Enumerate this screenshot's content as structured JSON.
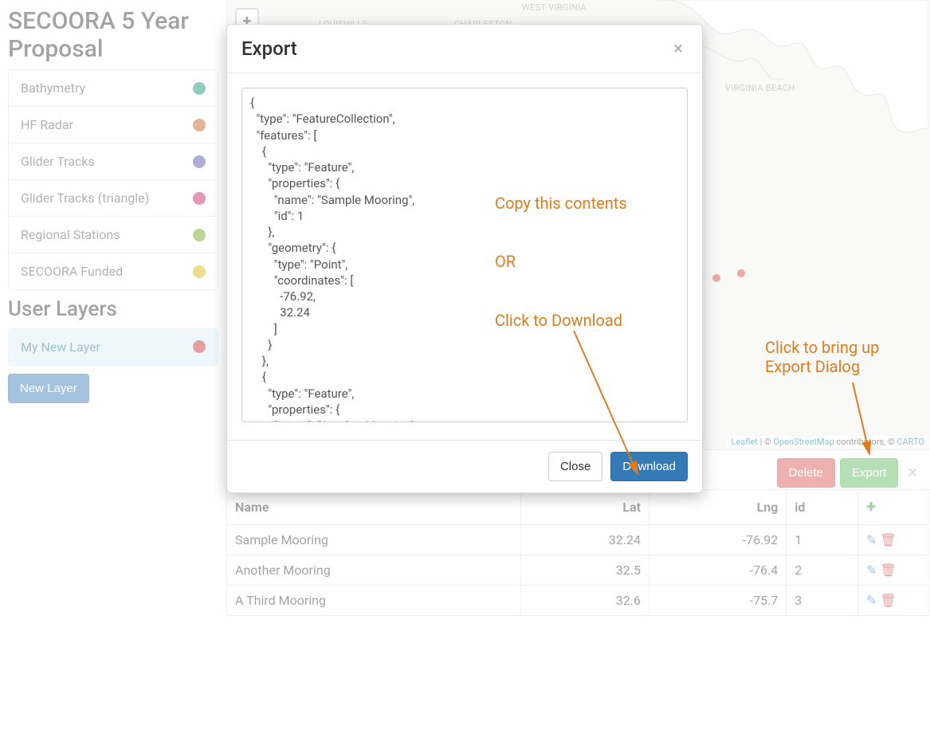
{
  "sidebar": {
    "title": "SECOORA 5 Year Proposal",
    "layers": [
      {
        "label": "Bathymetry",
        "color": "#0c8f6a"
      },
      {
        "label": "HF Radar",
        "color": "#c55a11"
      },
      {
        "label": "Glider Tracks",
        "color": "#4b4ca8"
      },
      {
        "label": "Glider Tracks (triangle)",
        "color": "#c2185b"
      },
      {
        "label": "Regional Stations",
        "color": "#6aa315"
      },
      {
        "label": "SECOORA Funded",
        "color": "#d4b106"
      }
    ],
    "user_section_title": "User Layers",
    "user_layers": [
      {
        "label": "My New Layer",
        "color": "#c62828",
        "selected": true
      }
    ],
    "new_layer_button": "New Layer"
  },
  "map": {
    "zoom_in": "+",
    "labels": {
      "wv": "WEST VIRGINIA",
      "charleston": "CHARLESTON",
      "louisville": "LOUISVILLE",
      "vabeach": "VIRGINIA BEACH"
    },
    "attribution": {
      "leaflet": "Leaflet",
      "sep1": " | © ",
      "osm": "OpenStreetMap",
      "contrib": " contributors, © ",
      "carto": "CARTO"
    }
  },
  "panel": {
    "delete_btn": "Delete",
    "export_btn": "Export",
    "headers": {
      "name": "Name",
      "lat": "Lat",
      "lng": "Lng",
      "id": "id"
    },
    "rows": [
      {
        "name": "Sample Mooring",
        "lat": "32.24",
        "lng": "-76.92",
        "id": "1"
      },
      {
        "name": "Another Mooring",
        "lat": "32.5",
        "lng": "-76.4",
        "id": "2"
      },
      {
        "name": "A Third Mooring",
        "lat": "32.6",
        "lng": "-75.7",
        "id": "3"
      }
    ]
  },
  "modal": {
    "title": "Export",
    "textarea": "{\n  \"type\": \"FeatureCollection\",\n  \"features\": [\n    {\n      \"type\": \"Feature\",\n      \"properties\": {\n        \"name\": \"Sample Mooring\",\n        \"id\": 1\n      },\n      \"geometry\": {\n        \"type\": \"Point\",\n        \"coordinates\": [\n          -76.92,\n          32.24\n        ]\n      }\n    },\n    {\n      \"type\": \"Feature\",\n      \"properties\": {\n        \"name\": \"Another Mooring\"",
    "close_btn": "Close",
    "download_btn": "Download"
  },
  "annotations": {
    "copy": "Copy this contents",
    "or": "OR",
    "click_dl": "Click to Download",
    "click_export": "Click to bring up\nExport Dialog"
  }
}
